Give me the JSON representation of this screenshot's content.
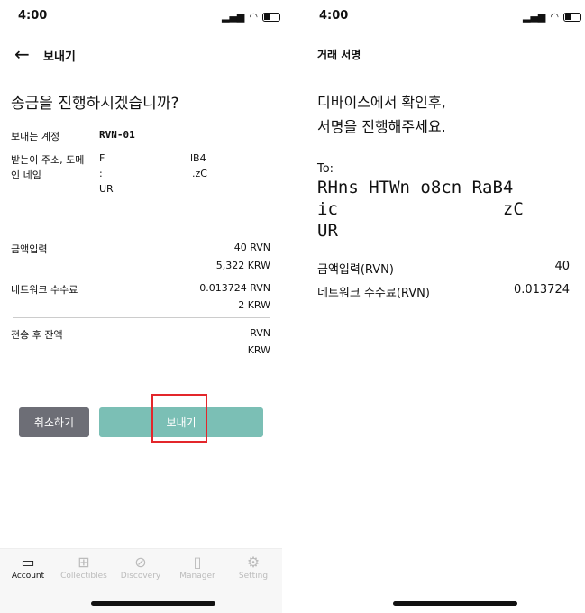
{
  "left": {
    "status_time": "4:00",
    "header_title": "보내기",
    "question": "송금을 진행하시겠습니까?",
    "rows": [
      {
        "label": "보내는 계정",
        "value": "RVN-01"
      },
      {
        "label": "받는이 주소, 도메인 네임",
        "address_fragments": [
          "F",
          "lB4",
          ":",
          ".zC",
          "UR"
        ]
      }
    ],
    "amount": {
      "label": "금액입력",
      "rvn": "40 RVN",
      "krw": "5,322 KRW"
    },
    "fee": {
      "label": "네트워크 수수료",
      "rvn": "0.013724 RVN",
      "krw": "2 KRW"
    },
    "balance": {
      "label": "전송 후 잔액",
      "rvn": "RVN",
      "krw": "KRW"
    },
    "cancel_label": "취소하기",
    "send_label": "보내기",
    "tabs": [
      {
        "label": "Account",
        "icon": "wallet-icon",
        "active": true
      },
      {
        "label": "Collectibles",
        "icon": "box-icon"
      },
      {
        "label": "Discovery",
        "icon": "planet-icon"
      },
      {
        "label": "Manager",
        "icon": "device-icon"
      },
      {
        "label": "Setting",
        "icon": "gear-icon"
      }
    ]
  },
  "right": {
    "status_time": "4:00",
    "header_title": "거래 서명",
    "instruction_line1": "디바이스에서 확인후,",
    "instruction_line2": "서명을 진행해주세요.",
    "to_label": "To:",
    "address_lines": [
      "RHns HTWn o8cn RaB4",
      "ic                zC",
      "UR"
    ],
    "amount_label": "금액입력(RVN)",
    "amount_value": "40",
    "fee_label": "네트워크 수수료(RVN)",
    "fee_value": "0.013724"
  },
  "colors": {
    "send": "#7bbfb5",
    "cancel": "#6d6e76",
    "highlight": "#e3262b"
  }
}
